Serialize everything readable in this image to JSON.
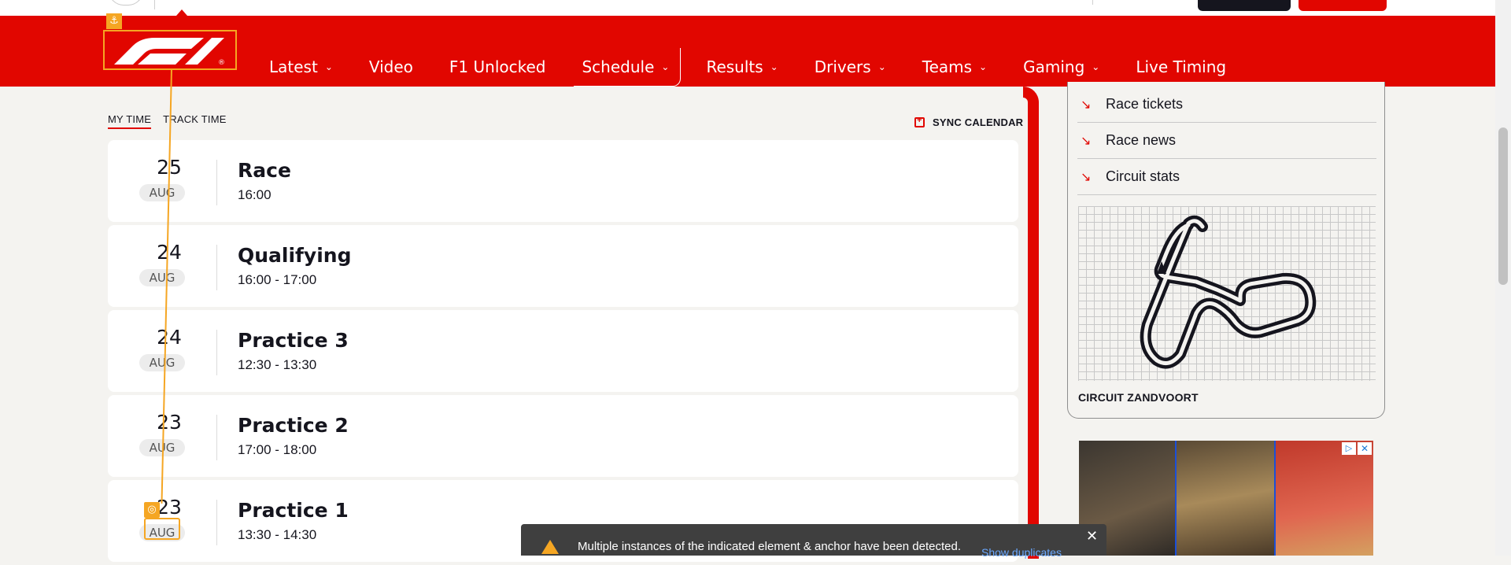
{
  "nav": {
    "items": [
      {
        "label": "Latest",
        "has_dropdown": true
      },
      {
        "label": "Video",
        "has_dropdown": false
      },
      {
        "label": "F1 Unlocked",
        "has_dropdown": false
      },
      {
        "label": "Schedule",
        "has_dropdown": true,
        "active": true
      },
      {
        "label": "Results",
        "has_dropdown": true
      },
      {
        "label": "Drivers",
        "has_dropdown": true
      },
      {
        "label": "Teams",
        "has_dropdown": true
      },
      {
        "label": "Gaming",
        "has_dropdown": true
      },
      {
        "label": "Live Timing",
        "has_dropdown": false
      }
    ],
    "chevron": "⌄"
  },
  "timezone_tabs": [
    {
      "label": "MY TIME",
      "active": true
    },
    {
      "label": "TRACK TIME",
      "active": false
    }
  ],
  "sync_calendar_label": "SYNC CALENDAR",
  "sessions": [
    {
      "day": "25",
      "month": "AUG",
      "name": "Race",
      "time": "16:00"
    },
    {
      "day": "24",
      "month": "AUG",
      "name": "Qualifying",
      "time": "16:00 - 17:00"
    },
    {
      "day": "24",
      "month": "AUG",
      "name": "Practice 3",
      "time": "12:30 - 13:30"
    },
    {
      "day": "23",
      "month": "AUG",
      "name": "Practice 2",
      "time": "17:00 - 18:00"
    },
    {
      "day": "23",
      "month": "AUG",
      "name": "Practice 1",
      "time": "13:30 - 14:30"
    }
  ],
  "sidebar": {
    "links": [
      {
        "label": "Race tickets",
        "icon": "arrow-down-right-icon"
      },
      {
        "label": "Race news",
        "icon": "arrow-down-right-icon"
      },
      {
        "label": "Circuit stats",
        "icon": "arrow-down-right-icon"
      }
    ],
    "circuit_name": "CIRCUIT ZANDVOORT"
  },
  "toast": {
    "message": "Multiple instances of the indicated element & anchor have been detected.",
    "link": "Show duplicates",
    "close": "✕"
  },
  "colors": {
    "brand_red": "#e10600",
    "highlight": "#f5a623",
    "page_bg": "#f4f3f0",
    "text": "#15151e"
  }
}
